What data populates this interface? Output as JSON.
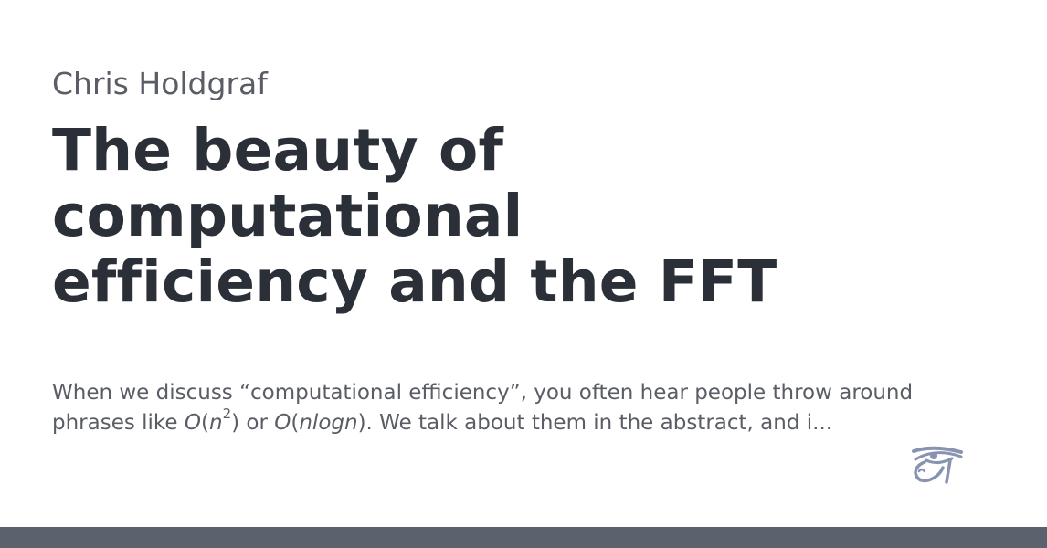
{
  "author": "Chris Holdgraf",
  "title_lines": [
    "The beauty of",
    "computational",
    "efficiency and the FFT"
  ],
  "description": {
    "line1": "When we discuss “computational efficiency”, you often hear people throw around",
    "line2_a": "phrases like ",
    "o1": "O",
    "p1": "(",
    "n1": "n",
    "exp": "2",
    "p1c": ")",
    "mid": " or ",
    "o2": "O",
    "p2": "(",
    "nlogn": "nlogn",
    "line2_end": "). We talk about them in the abstract, and i..."
  },
  "logo_icon": "eye-of-horus-icon",
  "colors": {
    "author": "#5a5d66",
    "title": "#2b3038",
    "logo": "#8793b0",
    "bar": "#5b616d"
  }
}
